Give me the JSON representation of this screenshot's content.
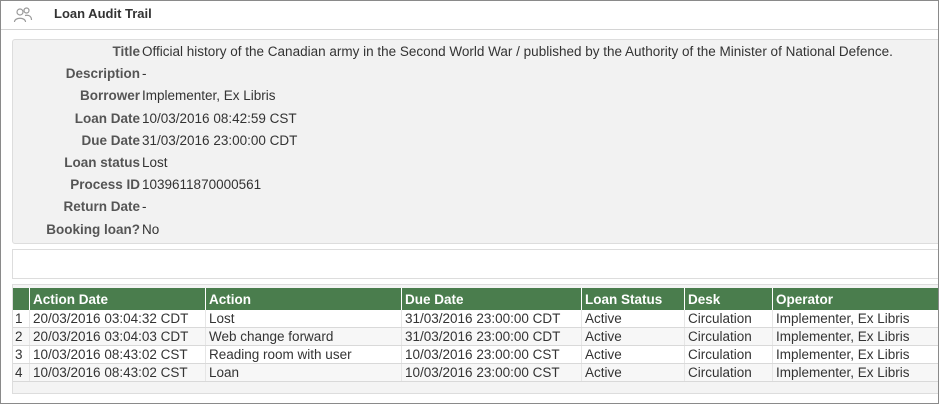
{
  "window": {
    "title": "Loan Audit Trail",
    "icon": "people-icon"
  },
  "details": {
    "fields": [
      {
        "label": "Title",
        "value": "Official history of the Canadian army in the Second World War / published by the Authority of the Minister of National Defence."
      },
      {
        "label": "Description",
        "value": "-"
      },
      {
        "label": "Borrower",
        "value": "Implementer, Ex Libris"
      },
      {
        "label": "Loan Date",
        "value": "10/03/2016 08:42:59 CST"
      },
      {
        "label": "Due Date",
        "value": "31/03/2016 23:00:00 CDT"
      },
      {
        "label": "Loan status",
        "value": "Lost"
      },
      {
        "label": "Process ID",
        "value": "1039611870000561"
      },
      {
        "label": "Return Date",
        "value": "-"
      },
      {
        "label": "Booking loan?",
        "value": "No"
      }
    ]
  },
  "table": {
    "header_color": "#4a7d4d",
    "columns": [
      "",
      "Action Date",
      "Action",
      "Due Date",
      "Loan Status",
      "Desk",
      "Operator"
    ],
    "rows": [
      [
        "1",
        "20/03/2016 03:04:32 CDT",
        "Lost",
        "31/03/2016 23:00:00 CDT",
        "Active",
        "Circulation",
        "Implementer, Ex Libris"
      ],
      [
        "2",
        "20/03/2016 03:04:03 CDT",
        "Web change forward",
        "31/03/2016 23:00:00 CDT",
        "Active",
        "Circulation",
        "Implementer, Ex Libris"
      ],
      [
        "3",
        "10/03/2016 08:43:02 CST",
        "Reading room with user",
        "10/03/2016 23:00:00 CST",
        "Active",
        "Circulation",
        "Implementer, Ex Libris"
      ],
      [
        "4",
        "10/03/2016 08:43:02 CST",
        "Loan",
        "10/03/2016 23:00:00 CST",
        "Active",
        "Circulation",
        "Implementer, Ex Libris"
      ]
    ]
  }
}
